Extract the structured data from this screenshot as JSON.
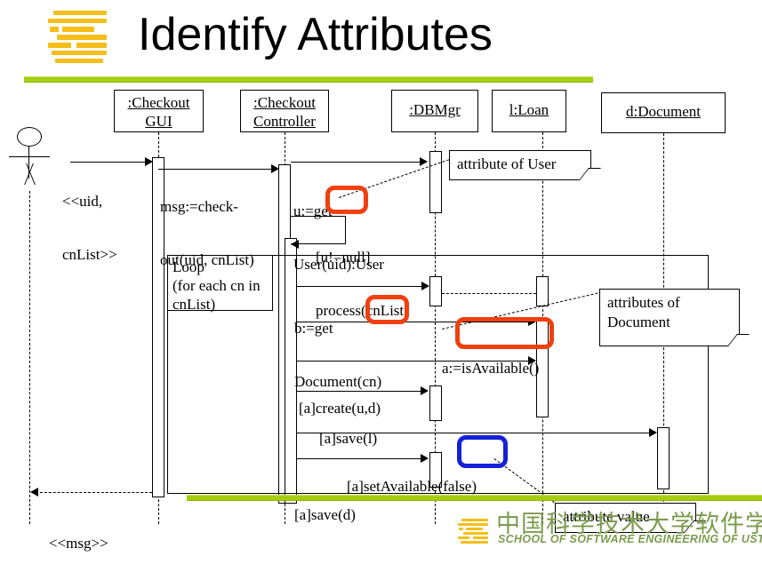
{
  "slide": {
    "title": "Identify Attributes",
    "accent_green": "#A6CE11",
    "logo_gold": "#F5BE18",
    "highlight_red": "#F04010",
    "highlight_blue": "#1521D8"
  },
  "footer": {
    "chinese": "中国科学技术大学软件学院",
    "english": "SCHOOL OF SOFTWARE ENGINEERING OF USTC"
  },
  "diagram": {
    "type": "uml-sequence",
    "actor": {
      "name": "user-actor",
      "label": ""
    },
    "participants": [
      {
        "id": "gui",
        "line1": ":Checkout",
        "line2": "GUI"
      },
      {
        "id": "controller",
        "line1": ":Checkout",
        "line2": "Controller"
      },
      {
        "id": "dbmgr",
        "line1": ":DBMgr",
        "line2": ""
      },
      {
        "id": "loan",
        "line1": "l:Loan",
        "line2": ""
      },
      {
        "id": "document",
        "line1": "d:Document",
        "line2": ""
      }
    ],
    "messages": [
      {
        "id": "m1",
        "text_line1": "<<uid,",
        "text_line2": "cnList>>"
      },
      {
        "id": "m2",
        "text_line1": "msg:=check-",
        "text_line2": "out(uid, cnList)"
      },
      {
        "id": "m3",
        "text_line1": "u:=get",
        "text_line2": "User(uid):User"
      },
      {
        "id": "m4",
        "text_line1": "[u!=null]",
        "text_line2": "process(cnList)"
      },
      {
        "id": "m5",
        "text_line1": "b:=get",
        "text_line2": "Document(cn)"
      },
      {
        "id": "m6",
        "text_line1": "a:=isAvailable()",
        "text_line2": ""
      },
      {
        "id": "m7",
        "text_line1": "[a]create(u,d)",
        "text_line2": ""
      },
      {
        "id": "m8",
        "text_line1": "[a]save(l)",
        "text_line2": ""
      },
      {
        "id": "m9",
        "text_line1": "[a]setAvailable(false)",
        "text_line2": ""
      },
      {
        "id": "m10",
        "text_line1": "[a]save(d)",
        "text_line2": ""
      },
      {
        "id": "m11",
        "text_line1": "<<msg>>",
        "text_line2": ""
      }
    ],
    "fragment": {
      "operator": "Loop",
      "guard_line1": "(for each cn in",
      "guard_line2": "cnList)"
    },
    "notes": [
      {
        "id": "n1",
        "line1": "attribute of User",
        "line2": ""
      },
      {
        "id": "n2",
        "line1": "attributes of",
        "line2": "Document"
      },
      {
        "id": "n3",
        "line1": "attribute value",
        "line2": ""
      }
    ],
    "highlights": [
      {
        "id": "h1",
        "color": "red",
        "targets": "uid)"
      },
      {
        "id": "h2",
        "color": "red",
        "targets": "(cn)"
      },
      {
        "id": "h3",
        "color": "red",
        "targets": "=isAvailable("
      },
      {
        "id": "h4",
        "color": "blue",
        "targets": "(false)"
      }
    ]
  }
}
